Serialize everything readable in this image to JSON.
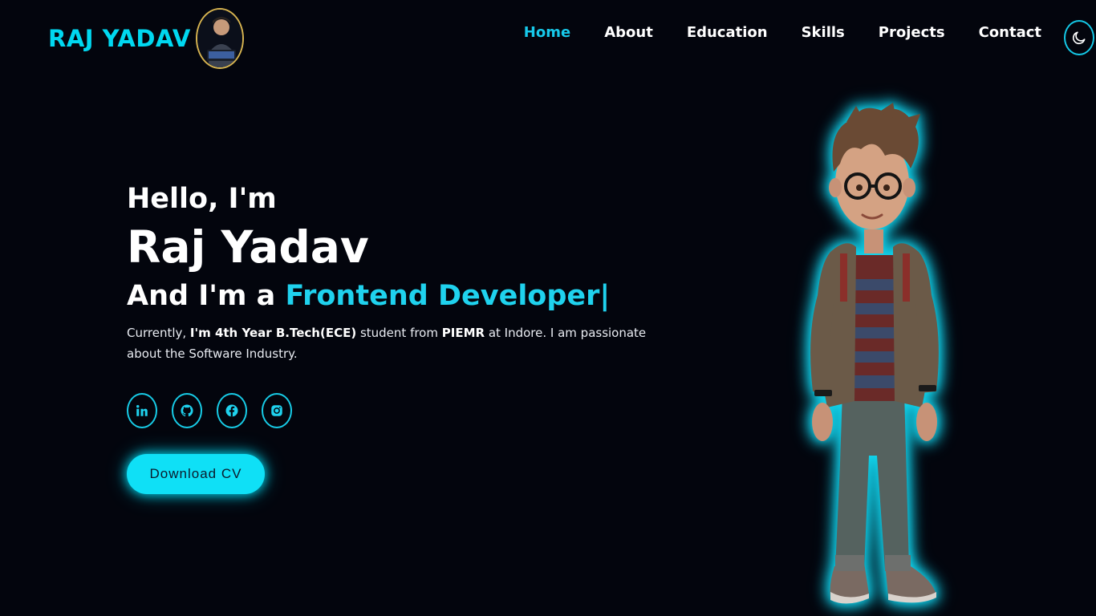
{
  "header": {
    "brand": "RAJ YADAV",
    "nav": [
      {
        "label": "Home",
        "active": true
      },
      {
        "label": "About",
        "active": false
      },
      {
        "label": "Education",
        "active": false
      },
      {
        "label": "Skills",
        "active": false
      },
      {
        "label": "Projects",
        "active": false
      },
      {
        "label": "Contact",
        "active": false
      }
    ],
    "theme_icon": "moon-icon"
  },
  "hero": {
    "greeting": "Hello, I'm",
    "name": "Raj Yadav",
    "role_prefix": "And I'm a ",
    "role_highlight": "Frontend Developer|",
    "desc_1": "Currently, ",
    "desc_2": "I'm 4th Year B.Tech(ECE)",
    "desc_3": " student from ",
    "desc_4": "PIEMR",
    "desc_5": " at Indore. I am passionate about the Software Industry.",
    "socials": [
      "linkedin-icon",
      "github-icon",
      "facebook-icon",
      "instagram-icon"
    ],
    "cv_button": "Download CV"
  },
  "colors": {
    "background": "#03050d",
    "accent": "#17c9ea",
    "button": "#0fe0f6"
  }
}
